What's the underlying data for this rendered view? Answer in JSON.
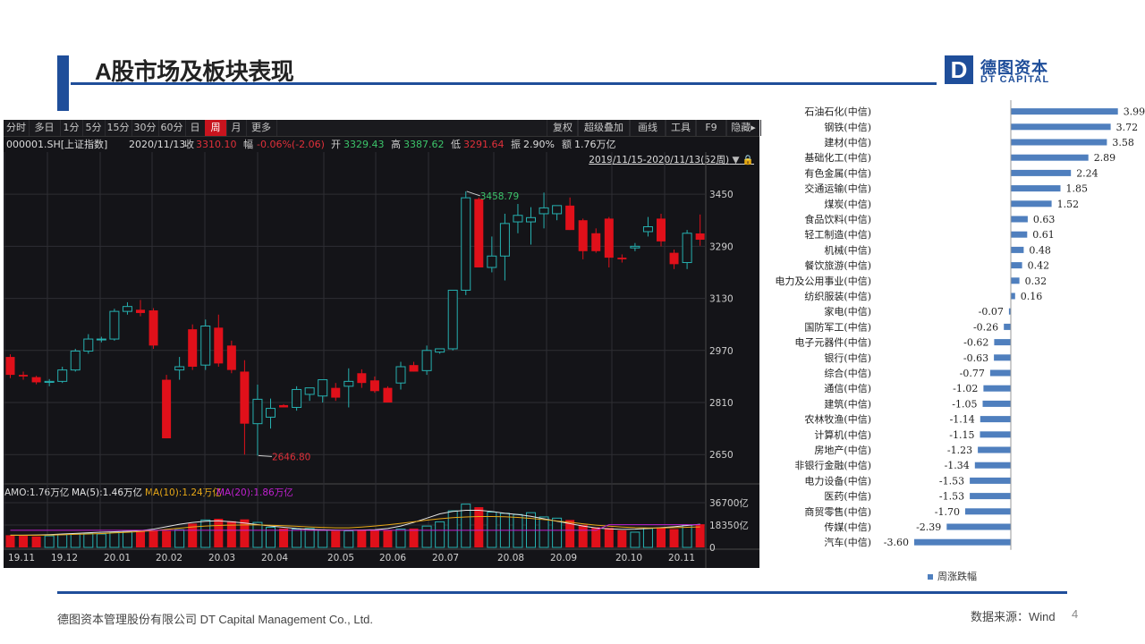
{
  "slide": {
    "title": "A股市场及板块表现",
    "logo_cn": "德图资本",
    "logo_en": "DT CAPITAL",
    "logo_letter": "D",
    "footer_left": "德图资本管理股份有限公司  DT Capital Management Co., Ltd.",
    "footer_right": "数据来源：Wind",
    "page_number": "4"
  },
  "terminal": {
    "toolbar_left": [
      "分时",
      "多日",
      "1分",
      "5分",
      "15分",
      "30分",
      "60分",
      "日",
      "周",
      "月",
      "更多"
    ],
    "active_tab": "周",
    "toolbar_right": [
      "复权",
      "超级叠加",
      "画线",
      "工具",
      "F9",
      "隐藏"
    ],
    "info": {
      "code": "000001.SH[上证指数]",
      "date": "2020/11/13",
      "close_label": "收",
      "close": "3310.10",
      "change_label": "幅",
      "change": "-0.06%(-2.06)",
      "open_label": "开",
      "open": "3329.43",
      "high_label": "高",
      "high": "3387.62",
      "low_label": "低",
      "low": "3291.64",
      "amp_label": "振",
      "amp": "2.90%",
      "amt_label": "额",
      "amt": "1.76万亿"
    },
    "range": "2019/11/15-2020/11/13(52周)",
    "amo_legend": {
      "amo": "AMO:1.76万亿",
      "ma5": "MA(5):1.46万亿",
      "ma10": "MA(10):1.24万亿",
      "ma20": "MA(20):1.86万亿"
    },
    "colors": {
      "up": "#26b0b0",
      "down": "#e0101a",
      "ma5": "#e6e6e6",
      "ma10": "#e8a817",
      "ma20": "#c020d0"
    }
  },
  "chart_data": [
    {
      "type": "candlestick",
      "title": "000001.SH[上证指数] 周K",
      "ylim": [
        2560,
        3530
      ],
      "yticks": [
        3450,
        3290,
        3130,
        2970,
        2810,
        2650
      ],
      "xticks": [
        "19.11",
        "19.12",
        "20.01",
        "20.02",
        "20.03",
        "20.04",
        "20.05",
        "20.06",
        "20.07",
        "20.08",
        "20.09",
        "20.10",
        "20.11"
      ],
      "annotations": [
        {
          "text": "3458.79",
          "value": 3458.79,
          "kind": "high"
        },
        {
          "text": "2646.80",
          "value": 2646.8,
          "kind": "low"
        }
      ],
      "ohlc": [
        [
          2950,
          2958,
          2885,
          2895
        ],
        [
          2895,
          2905,
          2880,
          2890
        ],
        [
          2888,
          2892,
          2866,
          2872
        ],
        [
          2872,
          2882,
          2860,
          2875
        ],
        [
          2875,
          2920,
          2870,
          2910
        ],
        [
          2910,
          2975,
          2905,
          2968
        ],
        [
          2968,
          3020,
          2960,
          3005
        ],
        [
          3003,
          3012,
          2995,
          3005
        ],
        [
          3005,
          3098,
          3000,
          3090
        ],
        [
          3090,
          3118,
          3080,
          3105
        ],
        [
          3095,
          3125,
          3075,
          3085
        ],
        [
          3093,
          3100,
          2975,
          2985
        ],
        [
          2880,
          2895,
          2700,
          2700
        ],
        [
          2910,
          2950,
          2880,
          2920
        ],
        [
          3035,
          3050,
          2910,
          2920
        ],
        [
          2925,
          3065,
          2910,
          3045
        ],
        [
          3040,
          3080,
          2920,
          2930
        ],
        [
          2985,
          3000,
          2900,
          2910
        ],
        [
          2905,
          2940,
          2650,
          2745
        ],
        [
          2745,
          2865,
          2646.8,
          2820
        ],
        [
          2765,
          2822,
          2730,
          2792
        ],
        [
          2802,
          2805,
          2795,
          2795
        ],
        [
          2795,
          2860,
          2785,
          2850
        ],
        [
          2835,
          2855,
          2815,
          2855
        ],
        [
          2830,
          2880,
          2810,
          2880
        ],
        [
          2855,
          2870,
          2815,
          2825
        ],
        [
          2860,
          2915,
          2795,
          2875
        ],
        [
          2900,
          2912,
          2855,
          2870
        ],
        [
          2878,
          2890,
          2840,
          2845
        ],
        [
          2855,
          2860,
          2810,
          2810
        ],
        [
          2870,
          2935,
          2850,
          2920
        ],
        [
          2925,
          2935,
          2905,
          2905
        ],
        [
          2908,
          2985,
          2895,
          2970
        ],
        [
          2965,
          2970,
          2960,
          2975
        ],
        [
          2975,
          2985,
          2970,
          3155
        ],
        [
          3155,
          3458.79,
          3140,
          3439
        ],
        [
          3435,
          3440,
          3225,
          3225
        ],
        [
          3225,
          3320,
          3210,
          3260
        ],
        [
          3260,
          3390,
          3185,
          3360
        ],
        [
          3365,
          3420,
          3330,
          3385
        ],
        [
          3365,
          3410,
          3295,
          3378
        ],
        [
          3390,
          3455,
          3345,
          3408
        ],
        [
          3390,
          3415,
          3370,
          3415
        ],
        [
          3415,
          3440,
          3340,
          3340
        ],
        [
          3370,
          3375,
          3250,
          3275
        ],
        [
          3330,
          3345,
          3270,
          3275
        ],
        [
          3375,
          3380,
          3225,
          3255
        ],
        [
          3255,
          3265,
          3240,
          3250
        ],
        [
          3285,
          3300,
          3275,
          3290
        ],
        [
          3335,
          3380,
          3320,
          3350
        ],
        [
          3375,
          3390,
          3290,
          3305
        ],
        [
          3270,
          3280,
          3220,
          3235
        ],
        [
          3240,
          3340,
          3220,
          3330
        ],
        [
          3329.43,
          3387.62,
          3291.64,
          3310.1
        ]
      ],
      "volume": {
        "ylim": [
          0,
          36700
        ],
        "yticks": [
          "36700亿",
          "18350亿",
          "0"
        ],
        "values": [
          10000,
          9500,
          9000,
          9500,
          10500,
          11000,
          11500,
          11000,
          12500,
          13000,
          13500,
          14000,
          13500,
          14500,
          19500,
          22500,
          23500,
          21500,
          23000,
          20500,
          16500,
          15500,
          15000,
          15500,
          14000,
          13500,
          13500,
          14000,
          14500,
          14000,
          15000,
          15500,
          17500,
          21000,
          30000,
          35500,
          33000,
          29000,
          28000,
          27000,
          28500,
          25000,
          24000,
          22500,
          18500,
          16500,
          16000,
          14000,
          12500,
          15500,
          16500,
          15000,
          18500,
          19000
        ],
        "ma5": [
          10000,
          10000,
          10200,
          10500,
          11000,
          11500,
          12000,
          12500,
          12800,
          13200,
          13800,
          15000,
          17000,
          19000,
          20500,
          21500,
          21800,
          21000,
          20000,
          18700,
          17500,
          16500,
          15500,
          14800,
          14500,
          14200,
          14100,
          14200,
          14500,
          15500,
          17500,
          20500,
          24000,
          27500,
          29500,
          30500,
          30500,
          29500,
          28000,
          27000,
          25500,
          23500,
          21500,
          19500,
          17500,
          16000,
          15200,
          14800,
          15000,
          15500,
          16200,
          17000,
          18000,
          19000
        ],
        "ma10": [
          10000,
          10000,
          10000,
          10100,
          10400,
          10700,
          11000,
          11400,
          11900,
          12400,
          13000,
          13800,
          14800,
          15800,
          16800,
          17500,
          18000,
          18300,
          18400,
          18400,
          18200,
          17800,
          17300,
          16800,
          16400,
          16100,
          16100,
          16700,
          17500,
          18500,
          19700,
          21000,
          22400,
          23500,
          24400,
          25000,
          25300,
          25300,
          25100,
          24600,
          23800,
          22800,
          21700,
          20600,
          19400,
          18300,
          17400,
          16700,
          16200,
          16000,
          16000,
          16200,
          16500,
          16800
        ],
        "ma20": [
          14000,
          14000,
          14000,
          14000,
          14000,
          14000,
          14000,
          14000,
          14000,
          14000,
          14000,
          14000,
          14000,
          14000,
          14000,
          14000,
          14000,
          14000,
          14000,
          14000,
          14000,
          14000,
          14000,
          14000,
          14000,
          14000,
          14000,
          14000,
          14000,
          14000,
          14000,
          14000,
          14000,
          14000,
          14000,
          14000,
          14000,
          14000,
          14000,
          14000,
          14000,
          14000,
          14000,
          14000,
          14000,
          14000,
          18600,
          18600,
          18600,
          18600,
          18600,
          18600,
          18600,
          18600
        ]
      }
    },
    {
      "type": "bar",
      "orientation": "horizontal",
      "series": [
        {
          "name": "周涨跌幅",
          "color": "#4f7fbe"
        }
      ],
      "categories": [
        "石油石化(中信)",
        "钢铁(中信)",
        "建材(中信)",
        "基础化工(中信)",
        "有色金属(中信)",
        "交通运输(中信)",
        "煤炭(中信)",
        "食品饮料(中信)",
        "轻工制造(中信)",
        "机械(中信)",
        "餐饮旅游(中信)",
        "电力及公用事业(中信)",
        "纺织服装(中信)",
        "家电(中信)",
        "国防军工(中信)",
        "电子元器件(中信)",
        "银行(中信)",
        "综合(中信)",
        "通信(中信)",
        "建筑(中信)",
        "农林牧渔(中信)",
        "计算机(中信)",
        "房地产(中信)",
        "非银行金融(中信)",
        "电力设备(中信)",
        "医药(中信)",
        "商贸零售(中信)",
        "传媒(中信)",
        "汽车(中信)"
      ],
      "values": [
        3.99,
        3.72,
        3.58,
        2.89,
        2.24,
        1.85,
        1.52,
        0.63,
        0.61,
        0.48,
        0.42,
        0.32,
        0.16,
        -0.07,
        -0.26,
        -0.62,
        -0.63,
        -0.77,
        -1.02,
        -1.05,
        -1.14,
        -1.15,
        -1.23,
        -1.34,
        -1.53,
        -1.53,
        -1.7,
        -2.39,
        -3.6
      ],
      "labels": [
        "3.99",
        "3.72",
        "3.58",
        "2.89",
        "2.24",
        "1.85",
        "1.52",
        "0.63",
        "0.61",
        "0.48",
        "0.42",
        "0.32",
        "0.16",
        "-0.07",
        "-0.26",
        "-0.62",
        "-0.63",
        "-0.77",
        "-1.02",
        "-1.05",
        "-1.14",
        "-1.15",
        "-1.23",
        "-1.34",
        "-1.53",
        "-1.53",
        "-1.70",
        "-2.39",
        "-3.60"
      ],
      "legend": "bottom"
    }
  ]
}
